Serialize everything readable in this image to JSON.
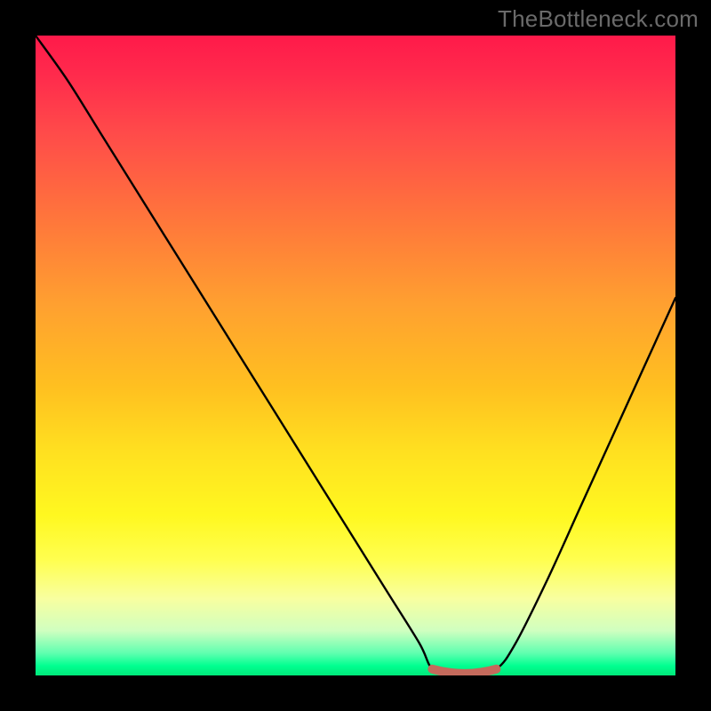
{
  "watermark": "TheBottleneck.com",
  "chart_data": {
    "type": "line",
    "title": "",
    "xlabel": "",
    "ylabel": "",
    "xlim": [
      0,
      100
    ],
    "ylim_note": "y is bottleneck percent; 0 at bottom, ~100 at top",
    "x": [
      0,
      5,
      10,
      15,
      20,
      25,
      30,
      35,
      40,
      45,
      50,
      55,
      60,
      62,
      65,
      68,
      72,
      75,
      80,
      85,
      90,
      95,
      100
    ],
    "y": [
      100,
      93,
      85,
      77,
      69,
      61,
      53,
      45,
      37,
      29,
      21,
      13,
      5,
      1,
      0,
      0,
      1,
      5,
      15,
      26,
      37,
      48,
      59
    ],
    "flat_minimum_x_range": [
      62,
      72
    ],
    "line_color": "#000000",
    "flat_segment_color": "#c46a5c",
    "background_gradient_stops": [
      {
        "pos": 0.0,
        "color": "#ff1a4a"
      },
      {
        "pos": 0.3,
        "color": "#ff7a3a"
      },
      {
        "pos": 0.65,
        "color": "#ffe020"
      },
      {
        "pos": 0.88,
        "color": "#f8ffa0"
      },
      {
        "pos": 0.97,
        "color": "#60ffb0"
      },
      {
        "pos": 1.0,
        "color": "#00e87a"
      }
    ]
  }
}
